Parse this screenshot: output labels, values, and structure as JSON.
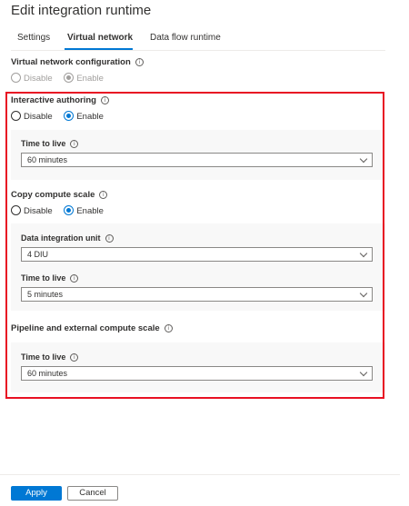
{
  "page": {
    "title": "Edit integration runtime"
  },
  "tabs": [
    {
      "label": "Settings"
    },
    {
      "label": "Virtual network"
    },
    {
      "label": "Data flow runtime"
    }
  ],
  "vnet": {
    "label": "Virtual network configuration",
    "options": [
      "Disable",
      "Enable"
    ],
    "selected": "Enable"
  },
  "interactive": {
    "label": "Interactive authoring",
    "options": [
      "Disable",
      "Enable"
    ],
    "selected": "Enable",
    "ttl_label": "Time to live",
    "ttl_value": "60 minutes"
  },
  "copy": {
    "label": "Copy compute scale",
    "options": [
      "Disable",
      "Enable"
    ],
    "selected": "Enable",
    "diu_label": "Data integration unit",
    "diu_value": "4 DIU",
    "ttl_label": "Time to live",
    "ttl_value": "5 minutes"
  },
  "pipeline": {
    "label": "Pipeline and external compute scale",
    "ttl_label": "Time to live",
    "ttl_value": "60 minutes"
  },
  "footer": {
    "apply": "Apply",
    "cancel": "Cancel"
  },
  "colors": {
    "accent": "#0078d4",
    "highlight": "#e81123"
  }
}
